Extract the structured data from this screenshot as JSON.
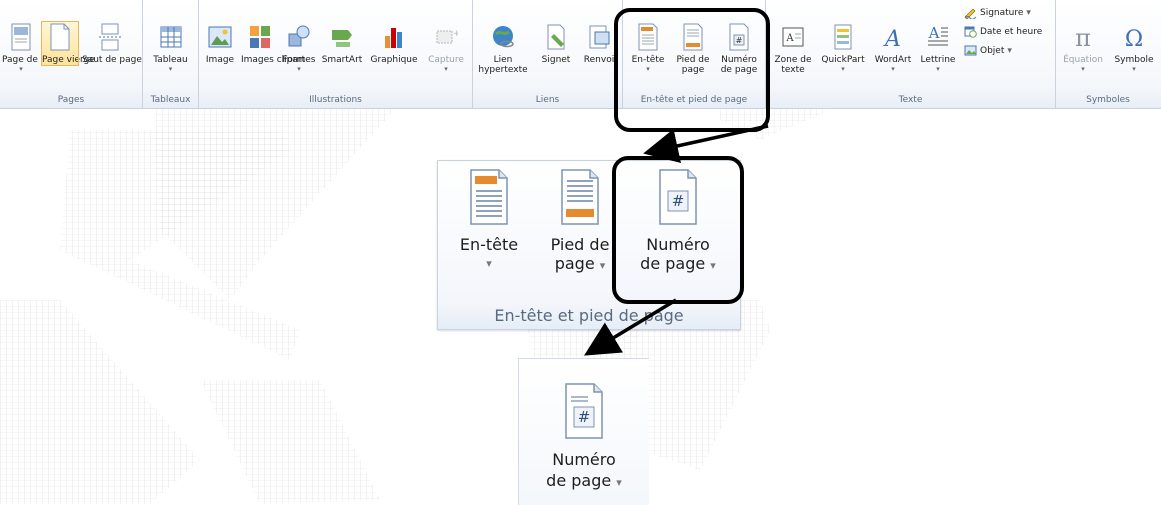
{
  "ribbon": {
    "groups": {
      "pages": "Pages",
      "tableaux": "Tableaux",
      "illustrations": "Illustrations",
      "liens": "Liens",
      "entete": "En-tête et pied de page",
      "texte": "Texte",
      "symboles": "Symboles"
    },
    "buttons": {
      "page_de_garde": "Page de garde",
      "page_vierge": "Page vierge",
      "saut_de_page": "Saut de page",
      "tableau": "Tableau",
      "image": "Image",
      "images_clipart": "Images clipart",
      "formes": "Formes",
      "smartart": "SmartArt",
      "graphique": "Graphique",
      "capture": "Capture",
      "lien_hypertexte": "Lien hypertexte",
      "signet": "Signet",
      "renvoi": "Renvoi",
      "en_tete": "En-tête",
      "pied_de_page": "Pied de page",
      "numero_de_page": "Numéro de page",
      "zone_de_texte": "Zone de texte",
      "quickpart": "QuickPart",
      "wordart": "WordArt",
      "lettrine": "Lettrine",
      "signature": "Signature",
      "date_et_heure": "Date et heure",
      "objet": "Objet",
      "equation": "Équation",
      "symbole": "Symbole"
    }
  },
  "zoom1": {
    "en_tete_line1": "En-tête",
    "pied_line1": "Pied de",
    "pied_line2": "page",
    "numero_line1": "Numéro",
    "numero_line2": "de page",
    "group_label": "En-tête et pied de page"
  },
  "zoom2": {
    "numero_line1": "Numéro",
    "numero_line2": "de page"
  },
  "colors": {
    "highlight": "#000000",
    "doc_orange": "#e68a2e",
    "doc_blue": "#4a78b5"
  }
}
